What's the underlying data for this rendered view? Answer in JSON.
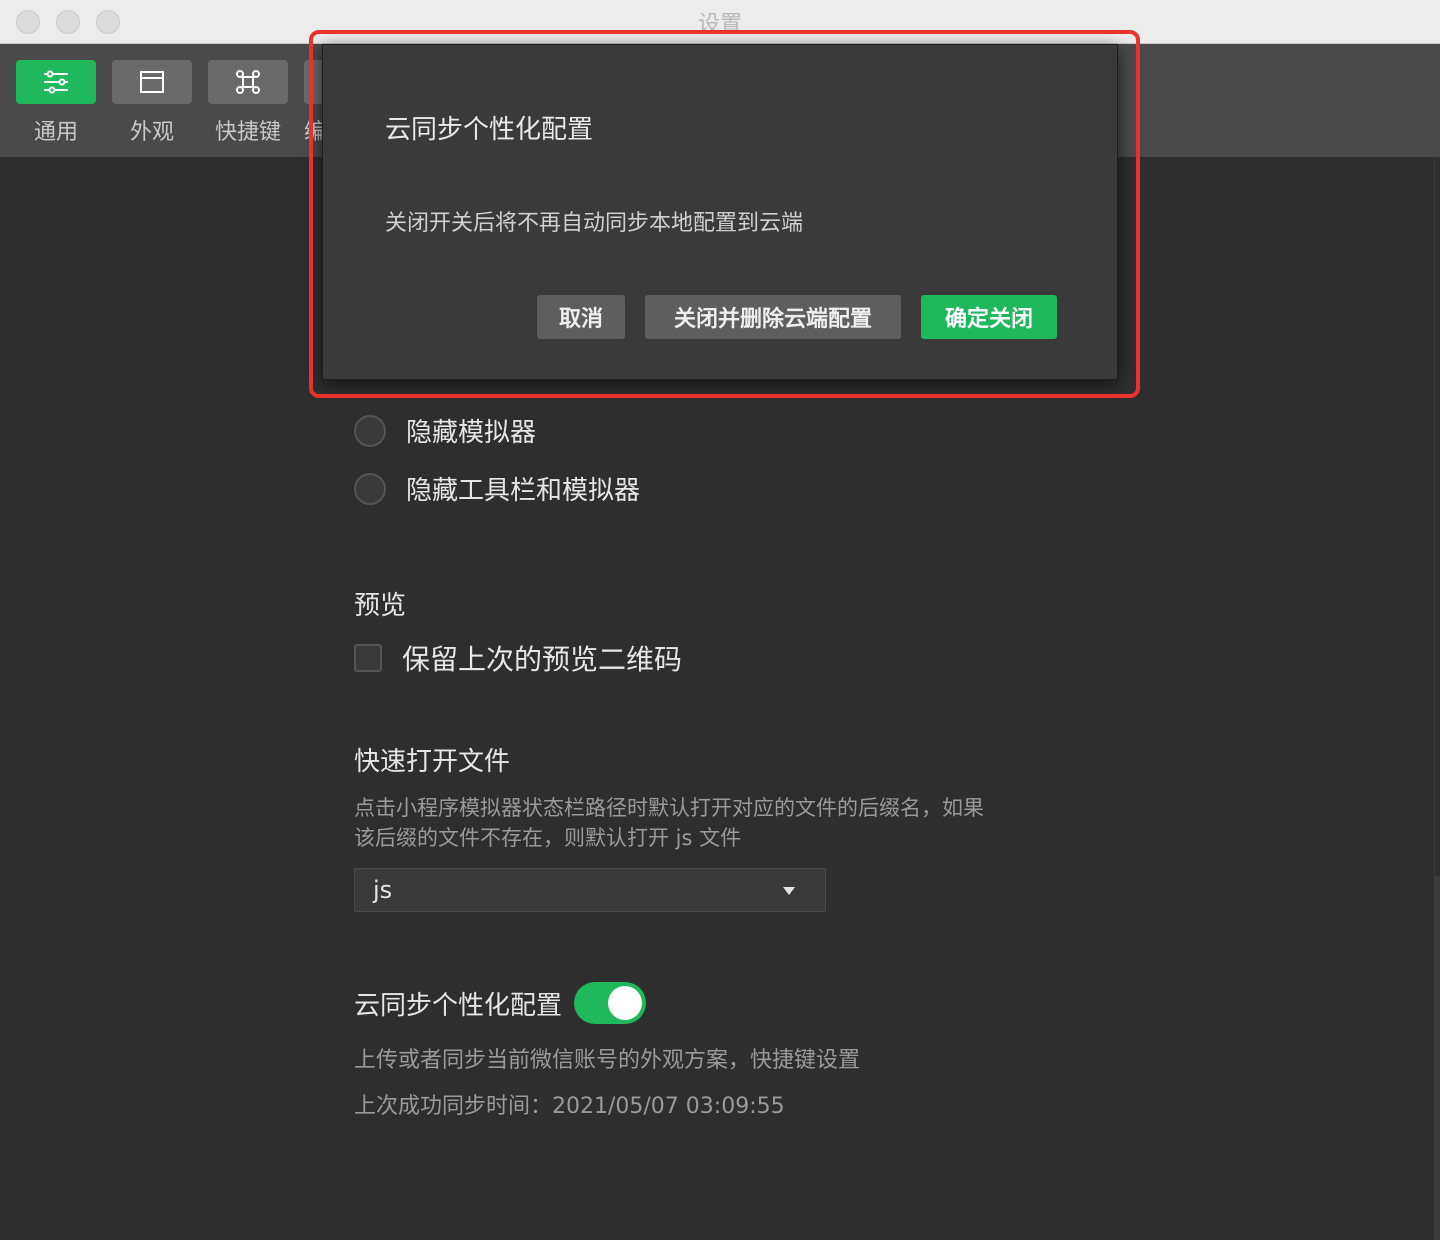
{
  "window": {
    "title": "设置"
  },
  "toolbar": {
    "items": [
      {
        "label": "通用",
        "icon": "sliders-icon",
        "active": true
      },
      {
        "label": "外观",
        "icon": "window-icon",
        "active": false
      },
      {
        "label": "快捷键",
        "icon": "command-icon",
        "active": false
      },
      {
        "label": "编",
        "icon": "partial-icon",
        "active": false
      }
    ]
  },
  "content": {
    "radio_hide_simulator": "隐藏模拟器",
    "radio_hide_toolbar_simulator": "隐藏工具栏和模拟器",
    "preview_title": "预览",
    "preview_checkbox": "保留上次的预览二维码",
    "quickopen_title": "快速打开文件",
    "quickopen_desc": "点击小程序模拟器状态栏路径时默认打开对应的文件的后缀名，如果该后缀的文件不存在，则默认打开 js 文件",
    "quickopen_select_value": "js",
    "cloud_title": "云同步个性化配置",
    "cloud_desc": "上传或者同步当前微信账号的外观方案，快捷键设置",
    "cloud_last_sync": "上次成功同步时间：2021/05/07 03:09:55"
  },
  "dialog": {
    "title": "云同步个性化配置",
    "message": "关闭开关后将不再自动同步本地配置到云端",
    "cancel": "取消",
    "close_delete": "关闭并删除云端配置",
    "confirm": "确定关闭"
  },
  "colors": {
    "accent": "#1fb85a",
    "highlight": "#e8322b",
    "background": "#2e2e2e"
  }
}
